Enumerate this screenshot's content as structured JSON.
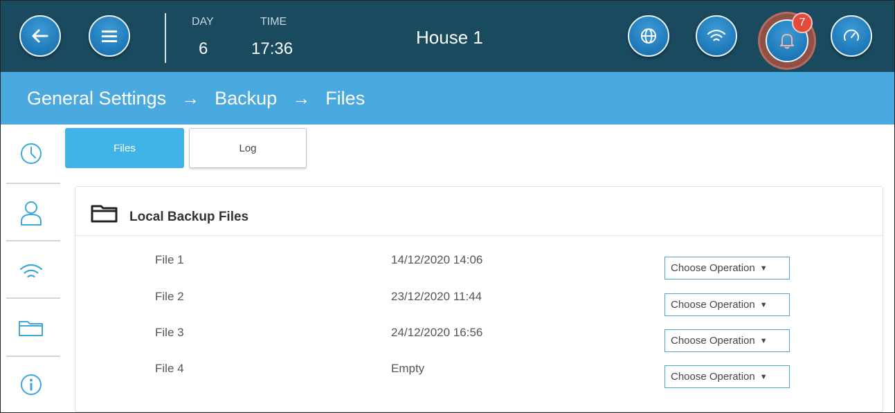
{
  "header": {
    "day_label": "DAY",
    "day_value": "6",
    "time_label": "TIME",
    "time_value": "17:36",
    "house_title": "House 1",
    "alarm_count": "7",
    "icons": [
      "back-arrow-icon",
      "menu-icon",
      "globe-icon",
      "wifi-icon",
      "bell-icon",
      "gauge-icon"
    ]
  },
  "breadcrumb": {
    "items": [
      "General Settings",
      "Backup",
      "Files"
    ],
    "separator": "→"
  },
  "sidebar": {
    "icons": [
      "clock-icon",
      "user-icon",
      "wifi-icon",
      "folder-icon",
      "info-icon"
    ]
  },
  "tabs": [
    {
      "label": "Files",
      "active": true
    },
    {
      "label": "Log",
      "active": false
    }
  ],
  "card": {
    "title": "Local Backup Files",
    "rows": [
      {
        "name": "File 1",
        "date": "14/12/2020  14:06",
        "operation": "Choose Operation"
      },
      {
        "name": "File 2",
        "date": "23/12/2020  11:44",
        "operation": "Choose Operation"
      },
      {
        "name": "File 3",
        "date": "24/12/2020  16:56",
        "operation": "Choose Operation"
      },
      {
        "name": "File 4",
        "date": "Empty",
        "operation": "Choose Operation"
      }
    ]
  },
  "colors": {
    "topbar": "#1a4a5e",
    "breadcrumb_bar": "#4aa9df",
    "active_tab": "#40b4e9",
    "alarm_badge": "#e34a3a",
    "select_border": "#4aa2d6"
  }
}
